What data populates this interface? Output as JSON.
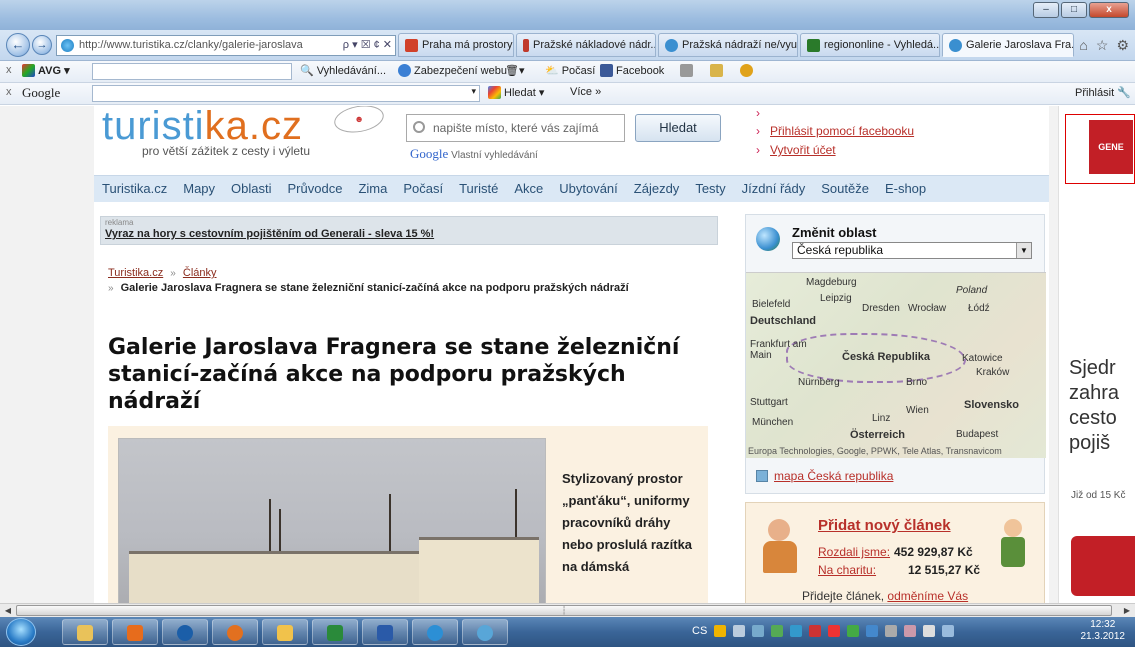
{
  "browser": {
    "url": "http://www.turistika.cz/clanky/galerie-jaroslava",
    "address_tools": "ρ ▾ ☒ ¢ ✕",
    "tabs": [
      {
        "label": "Praha má prostory pro ...",
        "color": "#d1412a"
      },
      {
        "label": "Pražské nákladové nádr...",
        "color": "#c0392b"
      },
      {
        "label": "Pražská nádraží ne/využ...",
        "color": "#3a8fd0"
      },
      {
        "label": "regiononline - Vyhledá...",
        "color": "#2a7a2a"
      },
      {
        "label": "Galerie Jaroslava Fra...",
        "color": "#3a8fd0",
        "active": true
      }
    ],
    "win_minimize": "–",
    "win_maximize": "□",
    "win_close": "x"
  },
  "toolbar1": {
    "close": "x",
    "avg_label": "AVG ▾",
    "search_label": "Vyhledávání...",
    "security_label": "Zabezpečení webu",
    "weather_label": "Počasí",
    "facebook_label": "Facebook"
  },
  "toolbar2": {
    "close": "x",
    "google_label": "Google",
    "search_button": "Hledat ▾",
    "more_label": "Více »",
    "login_label": "Přihlásit"
  },
  "site": {
    "logo_part1": "turisti",
    "logo_part2": "ka.cz",
    "logo_tagline": "pro větší zážitek z cesty i výletu",
    "search_placeholder": "napište místo, které vás zajímá",
    "search_button": "Hledat",
    "google_text": "Google",
    "google_note": "Vlastní vyhledávání",
    "login_links": [
      "Přihlásit pomocí facebooku",
      "Vytvořit účet"
    ],
    "menu": [
      "Turistika.cz",
      "Mapy",
      "Oblasti",
      "Průvodce",
      "Zima",
      "Počasí",
      "Turisté",
      "Akce",
      "Ubytování",
      "Zájezdy",
      "Testy",
      "Jízdní řády",
      "Soutěže",
      "E-shop"
    ],
    "ad_label": "reklama",
    "ad_text": "Vyraz na hory s cestovním pojištěním od Generali - sleva 15 %!",
    "breadcrumb": {
      "home": "Turistika.cz",
      "section": "Články",
      "current": "Galerie Jaroslava Fragnera se stane železniční stanicí-začíná akce na podporu pražských nádraží"
    },
    "article_title": "Galerie Jaroslava Fragnera se stane železniční stanicí-začíná akce na podporu pražských nádraží",
    "article_text": "Stylizovaný prostor „panťáku“, uniformy pracovníků dráhy nebo proslulá razítka na dámská",
    "region": {
      "heading": "Změnit oblast",
      "selected": "Česká republika",
      "map_copyright": "Europa Technologies, Google, PPWK, Tele Atlas, Transnavicom",
      "map_link": "mapa Česká republika",
      "map_labels": [
        "Magdeburg",
        "Leipzig",
        "Dresden",
        "Wrocław",
        "Łódź",
        "Deutschland",
        "Frankfurt am Main",
        "Česká Republika",
        "Nürnberg",
        "Brno",
        "Kraków",
        "Stuttgart",
        "Wien",
        "Slovensko",
        "München",
        "Linz",
        "Budapest",
        "Österreich",
        "Poland",
        "Katowice",
        "Bielefeld"
      ]
    },
    "add_article": {
      "title": "Přidat nový článek",
      "row1_label": "Rozdali jsme:",
      "row1_value": "452 929,87 Kč",
      "row2_label": "Na charitu:",
      "row2_value": "12 515,27 Kč",
      "bottom_text": "Přidejte článek,",
      "bottom_link": "odměníme Vás"
    },
    "right_ad": {
      "book_label": "GENE",
      "text": "Sjedr zahra cesto pojiš",
      "small": "Již od 15 Kč"
    }
  },
  "taskbar": {
    "tray_text": "CS",
    "time": "12:32",
    "date": "21.3.2012"
  }
}
